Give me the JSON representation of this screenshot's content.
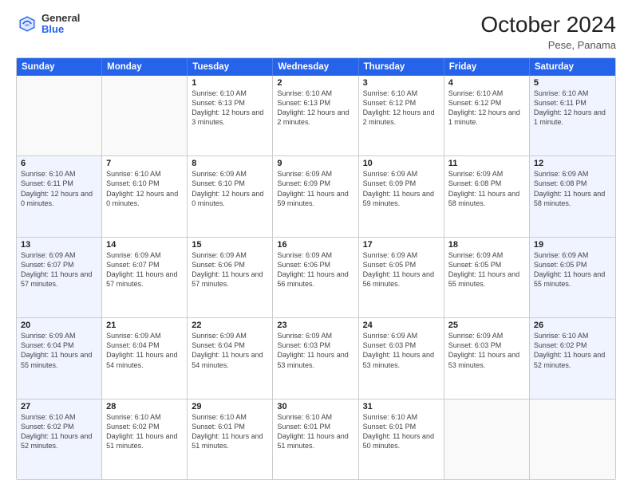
{
  "header": {
    "logo_general": "General",
    "logo_blue": "Blue",
    "month_title": "October 2024",
    "subtitle": "Pese, Panama"
  },
  "days_of_week": [
    "Sunday",
    "Monday",
    "Tuesday",
    "Wednesday",
    "Thursday",
    "Friday",
    "Saturday"
  ],
  "rows": [
    [
      {
        "day": "",
        "sunrise": "",
        "sunset": "",
        "daylight": "",
        "empty": true
      },
      {
        "day": "",
        "sunrise": "",
        "sunset": "",
        "daylight": "",
        "empty": true
      },
      {
        "day": "1",
        "sunrise": "Sunrise: 6:10 AM",
        "sunset": "Sunset: 6:13 PM",
        "daylight": "Daylight: 12 hours and 3 minutes."
      },
      {
        "day": "2",
        "sunrise": "Sunrise: 6:10 AM",
        "sunset": "Sunset: 6:13 PM",
        "daylight": "Daylight: 12 hours and 2 minutes."
      },
      {
        "day": "3",
        "sunrise": "Sunrise: 6:10 AM",
        "sunset": "Sunset: 6:12 PM",
        "daylight": "Daylight: 12 hours and 2 minutes."
      },
      {
        "day": "4",
        "sunrise": "Sunrise: 6:10 AM",
        "sunset": "Sunset: 6:12 PM",
        "daylight": "Daylight: 12 hours and 1 minute."
      },
      {
        "day": "5",
        "sunrise": "Sunrise: 6:10 AM",
        "sunset": "Sunset: 6:11 PM",
        "daylight": "Daylight: 12 hours and 1 minute.",
        "sat": true
      }
    ],
    [
      {
        "day": "6",
        "sunrise": "Sunrise: 6:10 AM",
        "sunset": "Sunset: 6:11 PM",
        "daylight": "Daylight: 12 hours and 0 minutes.",
        "sun": true
      },
      {
        "day": "7",
        "sunrise": "Sunrise: 6:10 AM",
        "sunset": "Sunset: 6:10 PM",
        "daylight": "Daylight: 12 hours and 0 minutes."
      },
      {
        "day": "8",
        "sunrise": "Sunrise: 6:09 AM",
        "sunset": "Sunset: 6:10 PM",
        "daylight": "Daylight: 12 hours and 0 minutes."
      },
      {
        "day": "9",
        "sunrise": "Sunrise: 6:09 AM",
        "sunset": "Sunset: 6:09 PM",
        "daylight": "Daylight: 11 hours and 59 minutes."
      },
      {
        "day": "10",
        "sunrise": "Sunrise: 6:09 AM",
        "sunset": "Sunset: 6:09 PM",
        "daylight": "Daylight: 11 hours and 59 minutes."
      },
      {
        "day": "11",
        "sunrise": "Sunrise: 6:09 AM",
        "sunset": "Sunset: 6:08 PM",
        "daylight": "Daylight: 11 hours and 58 minutes."
      },
      {
        "day": "12",
        "sunrise": "Sunrise: 6:09 AM",
        "sunset": "Sunset: 6:08 PM",
        "daylight": "Daylight: 11 hours and 58 minutes.",
        "sat": true
      }
    ],
    [
      {
        "day": "13",
        "sunrise": "Sunrise: 6:09 AM",
        "sunset": "Sunset: 6:07 PM",
        "daylight": "Daylight: 11 hours and 57 minutes.",
        "sun": true
      },
      {
        "day": "14",
        "sunrise": "Sunrise: 6:09 AM",
        "sunset": "Sunset: 6:07 PM",
        "daylight": "Daylight: 11 hours and 57 minutes."
      },
      {
        "day": "15",
        "sunrise": "Sunrise: 6:09 AM",
        "sunset": "Sunset: 6:06 PM",
        "daylight": "Daylight: 11 hours and 57 minutes."
      },
      {
        "day": "16",
        "sunrise": "Sunrise: 6:09 AM",
        "sunset": "Sunset: 6:06 PM",
        "daylight": "Daylight: 11 hours and 56 minutes."
      },
      {
        "day": "17",
        "sunrise": "Sunrise: 6:09 AM",
        "sunset": "Sunset: 6:05 PM",
        "daylight": "Daylight: 11 hours and 56 minutes."
      },
      {
        "day": "18",
        "sunrise": "Sunrise: 6:09 AM",
        "sunset": "Sunset: 6:05 PM",
        "daylight": "Daylight: 11 hours and 55 minutes."
      },
      {
        "day": "19",
        "sunrise": "Sunrise: 6:09 AM",
        "sunset": "Sunset: 6:05 PM",
        "daylight": "Daylight: 11 hours and 55 minutes.",
        "sat": true
      }
    ],
    [
      {
        "day": "20",
        "sunrise": "Sunrise: 6:09 AM",
        "sunset": "Sunset: 6:04 PM",
        "daylight": "Daylight: 11 hours and 55 minutes.",
        "sun": true
      },
      {
        "day": "21",
        "sunrise": "Sunrise: 6:09 AM",
        "sunset": "Sunset: 6:04 PM",
        "daylight": "Daylight: 11 hours and 54 minutes."
      },
      {
        "day": "22",
        "sunrise": "Sunrise: 6:09 AM",
        "sunset": "Sunset: 6:04 PM",
        "daylight": "Daylight: 11 hours and 54 minutes."
      },
      {
        "day": "23",
        "sunrise": "Sunrise: 6:09 AM",
        "sunset": "Sunset: 6:03 PM",
        "daylight": "Daylight: 11 hours and 53 minutes."
      },
      {
        "day": "24",
        "sunrise": "Sunrise: 6:09 AM",
        "sunset": "Sunset: 6:03 PM",
        "daylight": "Daylight: 11 hours and 53 minutes."
      },
      {
        "day": "25",
        "sunrise": "Sunrise: 6:09 AM",
        "sunset": "Sunset: 6:03 PM",
        "daylight": "Daylight: 11 hours and 53 minutes."
      },
      {
        "day": "26",
        "sunrise": "Sunrise: 6:10 AM",
        "sunset": "Sunset: 6:02 PM",
        "daylight": "Daylight: 11 hours and 52 minutes.",
        "sat": true
      }
    ],
    [
      {
        "day": "27",
        "sunrise": "Sunrise: 6:10 AM",
        "sunset": "Sunset: 6:02 PM",
        "daylight": "Daylight: 11 hours and 52 minutes.",
        "sun": true
      },
      {
        "day": "28",
        "sunrise": "Sunrise: 6:10 AM",
        "sunset": "Sunset: 6:02 PM",
        "daylight": "Daylight: 11 hours and 51 minutes."
      },
      {
        "day": "29",
        "sunrise": "Sunrise: 6:10 AM",
        "sunset": "Sunset: 6:01 PM",
        "daylight": "Daylight: 11 hours and 51 minutes."
      },
      {
        "day": "30",
        "sunrise": "Sunrise: 6:10 AM",
        "sunset": "Sunset: 6:01 PM",
        "daylight": "Daylight: 11 hours and 51 minutes."
      },
      {
        "day": "31",
        "sunrise": "Sunrise: 6:10 AM",
        "sunset": "Sunset: 6:01 PM",
        "daylight": "Daylight: 11 hours and 50 minutes."
      },
      {
        "day": "",
        "sunrise": "",
        "sunset": "",
        "daylight": "",
        "empty": true
      },
      {
        "day": "",
        "sunrise": "",
        "sunset": "",
        "daylight": "",
        "empty": true,
        "sat": true
      }
    ]
  ]
}
